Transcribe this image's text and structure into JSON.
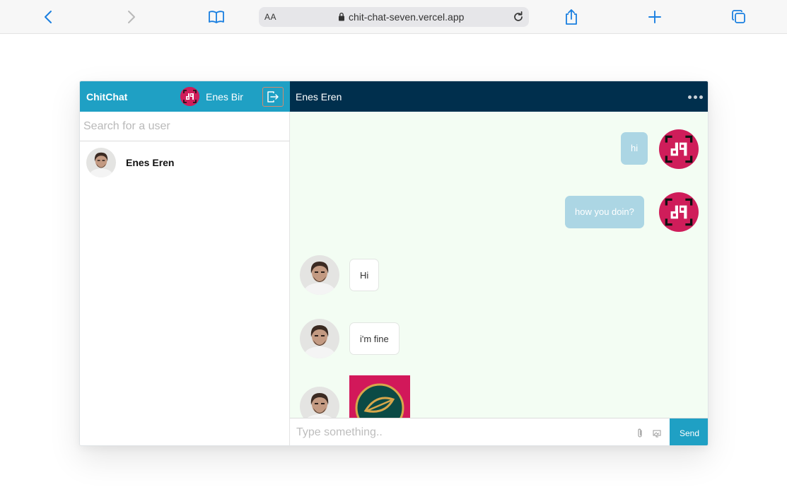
{
  "browser": {
    "aa_label": "AA",
    "url": "chit-chat-seven.vercel.app",
    "icons": [
      "back-icon",
      "forward-icon",
      "bookmarks-icon",
      "lock-icon",
      "reload-icon",
      "share-icon",
      "new-tab-icon",
      "tabs-icon"
    ]
  },
  "sidebar": {
    "brand": "ChitChat",
    "current_user": "Enes Bir",
    "search_placeholder": "Search for a user",
    "contacts": [
      {
        "name": "Enes Eren"
      }
    ]
  },
  "chat": {
    "title": "Enes Eren",
    "messages": [
      {
        "direction": "out",
        "text": "hi"
      },
      {
        "direction": "out",
        "text": "how you doin?"
      },
      {
        "direction": "in",
        "text": "Hi"
      },
      {
        "direction": "in",
        "text": "i'm fine"
      },
      {
        "direction": "in",
        "type": "image"
      }
    ],
    "composer_placeholder": "Type something..",
    "send_label": "Send"
  },
  "colors": {
    "sidebar_header": "#1fa0c4",
    "chat_header": "#002f4d",
    "chat_background": "#f3fdf3",
    "outgoing_bubble": "#acd6e4",
    "send_button": "#1fa0c4",
    "brand_avatar": "#cf1d5a"
  }
}
